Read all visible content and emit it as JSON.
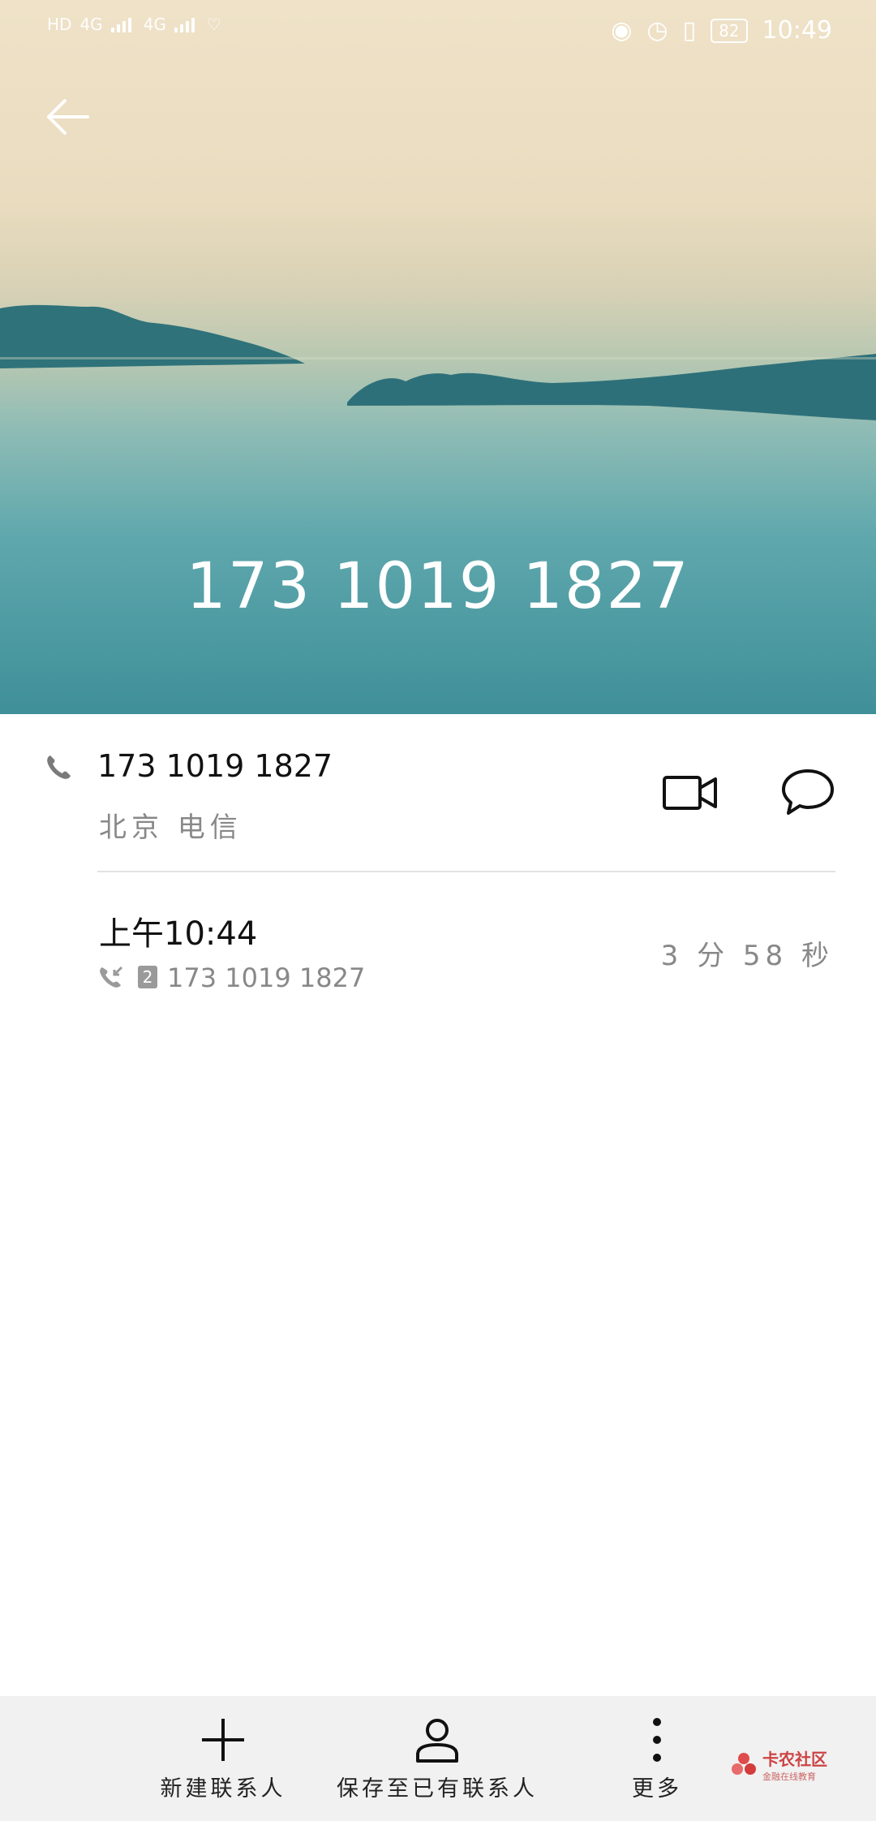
{
  "status_bar": {
    "left_items": [
      "HD",
      "4G",
      "4G"
    ],
    "battery": "82",
    "time": "10:49"
  },
  "header": {
    "number": "173 1019 1827"
  },
  "contact": {
    "number": "173 1019 1827",
    "location": "北京 电信"
  },
  "call_log": {
    "time": "上午10:44",
    "sim": "2",
    "number": "173 1019 1827",
    "duration": "3 分 58 秒"
  },
  "bottom_bar": {
    "new_contact": "新建联系人",
    "save_existing": "保存至已有联系人",
    "more": "更多"
  },
  "watermark": {
    "title": "卡农社区",
    "subtitle": "金融在线教育"
  }
}
